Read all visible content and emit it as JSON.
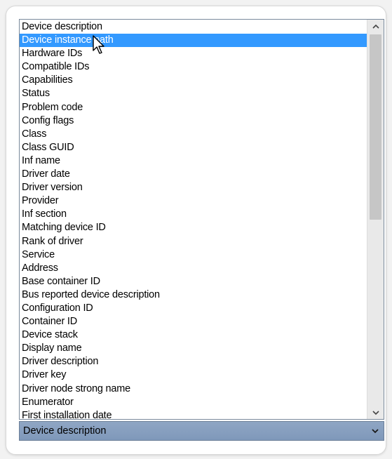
{
  "list": {
    "items": [
      {
        "label": "Device description",
        "selected": false
      },
      {
        "label": "Device instance path",
        "selected": true
      },
      {
        "label": "Hardware IDs",
        "selected": false
      },
      {
        "label": "Compatible IDs",
        "selected": false
      },
      {
        "label": "Capabilities",
        "selected": false
      },
      {
        "label": "Status",
        "selected": false
      },
      {
        "label": "Problem code",
        "selected": false
      },
      {
        "label": "Config flags",
        "selected": false
      },
      {
        "label": "Class",
        "selected": false
      },
      {
        "label": "Class GUID",
        "selected": false
      },
      {
        "label": "Inf name",
        "selected": false
      },
      {
        "label": "Driver date",
        "selected": false
      },
      {
        "label": "Driver version",
        "selected": false
      },
      {
        "label": "Provider",
        "selected": false
      },
      {
        "label": "Inf section",
        "selected": false
      },
      {
        "label": "Matching device ID",
        "selected": false
      },
      {
        "label": "Rank of driver",
        "selected": false
      },
      {
        "label": "Service",
        "selected": false
      },
      {
        "label": "Address",
        "selected": false
      },
      {
        "label": "Base container ID",
        "selected": false
      },
      {
        "label": "Bus reported device description",
        "selected": false
      },
      {
        "label": "Configuration ID",
        "selected": false
      },
      {
        "label": "Container ID",
        "selected": false
      },
      {
        "label": "Device stack",
        "selected": false
      },
      {
        "label": "Display name",
        "selected": false
      },
      {
        "label": "Driver description",
        "selected": false
      },
      {
        "label": "Driver key",
        "selected": false
      },
      {
        "label": "Driver node strong name",
        "selected": false
      },
      {
        "label": "Enumerator",
        "selected": false
      },
      {
        "label": "First installation date",
        "selected": false
      }
    ],
    "selection_color": "#3399ff",
    "scroll_position_fraction": 0.0
  },
  "combo": {
    "selected_value": "Device description",
    "dropdown_icon": "chevron-down-icon"
  },
  "icons": {
    "scroll_up": "chevron-up-icon",
    "scroll_down": "chevron-down-icon",
    "cursor": "mouse-pointer-icon"
  }
}
